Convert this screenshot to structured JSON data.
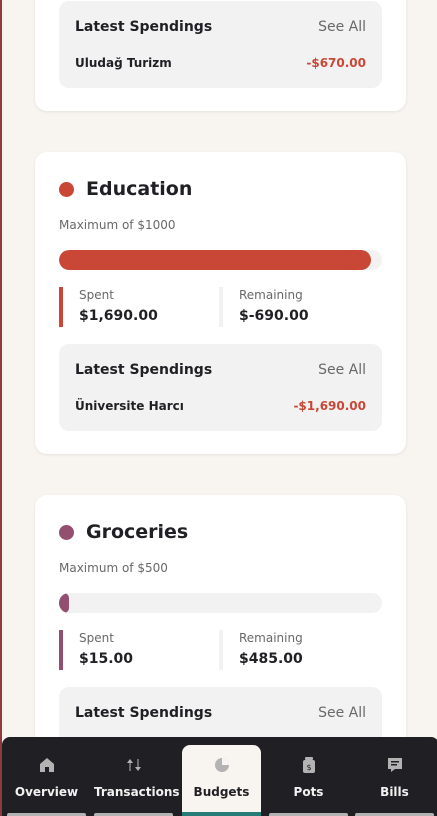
{
  "cards": [
    {
      "latest_title": "Latest Spendings",
      "see_all": "See All",
      "spending": {
        "name": "Uludağ Turizm",
        "amount": "-$670.00"
      }
    },
    {
      "name": "Education",
      "color": "#c94736",
      "max_text": "Maximum of $1000",
      "progress": 1.0,
      "spent_label": "Spent",
      "spent_value": "$1,690.00",
      "remaining_label": "Remaining",
      "remaining_value": "$-690.00",
      "latest_title": "Latest Spendings",
      "see_all": "See All",
      "spending": {
        "name": "Üniversite Harcı",
        "amount": "-$1,690.00"
      }
    },
    {
      "name": "Groceries",
      "color": "#934f6f",
      "max_text": "Maximum of $500",
      "progress": 0.03,
      "spent_label": "Spent",
      "spent_value": "$15.00",
      "remaining_label": "Remaining",
      "remaining_value": "$485.00",
      "latest_title": "Latest Spendings",
      "see_all": "See All"
    }
  ],
  "negative_color": "#c94736",
  "nav": {
    "items": [
      {
        "label": "Overview",
        "icon": "home-icon"
      },
      {
        "label": "Transactions",
        "icon": "arrows-up-down-icon"
      },
      {
        "label": "Budgets",
        "icon": "pie-chart-icon",
        "active": true
      },
      {
        "label": "Pots",
        "icon": "jar-icon"
      },
      {
        "label": "Bills",
        "icon": "receipt-icon"
      }
    ]
  }
}
